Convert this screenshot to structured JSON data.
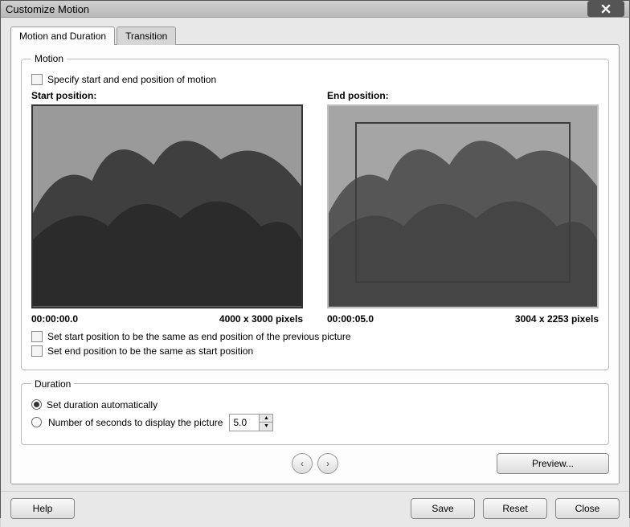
{
  "window": {
    "title": "Customize Motion"
  },
  "tabs": {
    "motion_duration": "Motion and Duration",
    "transition": "Transition"
  },
  "motion": {
    "legend": "Motion",
    "specify_checkbox": "Specify start and end position of motion",
    "start_label": "Start position:",
    "end_label": "End position:",
    "start_time": "00:00:00.0",
    "start_dims": "4000 x 3000 pixels",
    "end_time": "00:00:05.0",
    "end_dims": "3004 x 2253 pixels",
    "same_as_prev": "Set start position to be the same as end position of the previous picture",
    "same_as_start": "Set end position to be the same as start position"
  },
  "duration": {
    "legend": "Duration",
    "auto": "Set duration automatically",
    "seconds_label": "Number of seconds to display the picture",
    "seconds_value": "5.0"
  },
  "nav": {
    "prev": "‹",
    "next": "›",
    "preview": "Preview..."
  },
  "buttons": {
    "help": "Help",
    "save": "Save",
    "reset": "Reset",
    "close": "Close"
  }
}
